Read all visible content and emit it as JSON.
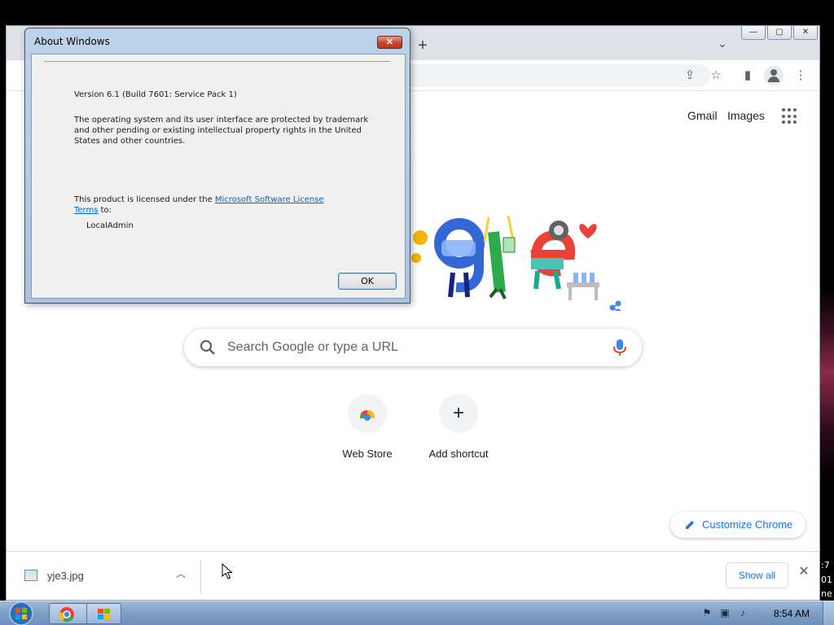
{
  "desktop": {
    "right_fragments": [
      ":7",
      "01",
      "ne"
    ]
  },
  "chrome": {
    "new_tab_glyph": "+",
    "tab_search_glyph": "⌄",
    "caption": {
      "minimize": "—",
      "maximize": "▢",
      "close": "✕"
    },
    "toolbar": {
      "share_glyph": "⇪",
      "star_glyph": "☆",
      "sidepanel_glyph": "▮",
      "menu_glyph": "⋮"
    },
    "ntp": {
      "gmail_label": "Gmail",
      "images_label": "Images",
      "search_placeholder": "Search Google or type a URL",
      "shortcuts": [
        {
          "label": "Web Store",
          "icon": "web-store-icon"
        },
        {
          "label": "Add shortcut",
          "icon": "plus-icon",
          "glyph": "+"
        }
      ],
      "customize_label": "Customize Chrome"
    },
    "downloads": {
      "file_name": "yje3.jpg",
      "chevron_glyph": "︿",
      "show_all_label": "Show all",
      "close_glyph": "✕"
    }
  },
  "dialog": {
    "title": "About Windows",
    "close_glyph": "✕",
    "version": "Version 6.1 (Build 7601: Service Pack 1)",
    "trademark_lines": [
      "The  operating system and its user interface are protected by trademark",
      "and other pending or existing intellectual property rights in the United",
      "States and other countries."
    ],
    "license_prefix": "This product is licensed under the ",
    "license_link_1": "Microsoft Software License",
    "license_link_2": "Terms",
    "license_suffix": " to:",
    "licensee": "LocalAdmin",
    "ok_label": "OK"
  },
  "taskbar": {
    "clock": "8:54 AM",
    "colors": {
      "accent": "#1a73e8",
      "taskbar": "#7f9ec6"
    }
  }
}
